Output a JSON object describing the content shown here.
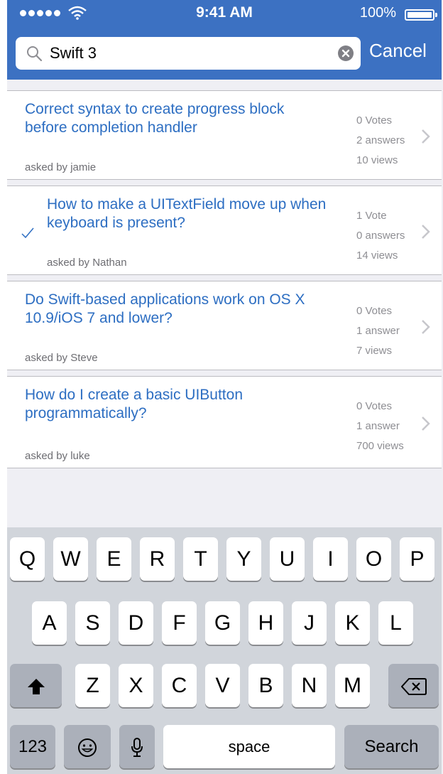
{
  "status_bar": {
    "time": "9:41 AM",
    "battery": "100%"
  },
  "search": {
    "query": "Swift 3",
    "cancel_label": "Cancel"
  },
  "results": [
    {
      "title": "Correct syntax to create progress block before completion handler",
      "asked": "asked by jamie",
      "votes": "0 Votes",
      "answers": "2 answers",
      "views": "10 views",
      "checked": false
    },
    {
      "title": "How to make a UITextField move up when keyboard is present?",
      "asked": "asked by Nathan",
      "votes": "1 Vote",
      "answers": "0 answers",
      "views": "14 views",
      "checked": true
    },
    {
      "title": "Do Swift-based applications work on OS X 10.9/iOS 7 and lower?",
      "asked": "asked by Steve",
      "votes": "0 Votes",
      "answers": "1 answer",
      "views": "7 views",
      "checked": false
    },
    {
      "title": "How do I create a basic UIButton programmatically?",
      "asked": "asked by luke",
      "votes": "0 Votes",
      "answers": "1 answer",
      "views": "700 views",
      "checked": false
    }
  ],
  "keyboard": {
    "row1": [
      "Q",
      "W",
      "E",
      "R",
      "T",
      "Y",
      "U",
      "I",
      "O",
      "P"
    ],
    "row2": [
      "A",
      "S",
      "D",
      "F",
      "G",
      "H",
      "J",
      "K",
      "L"
    ],
    "row3": [
      "Z",
      "X",
      "C",
      "V",
      "B",
      "N",
      "M"
    ],
    "numbers_label": "123",
    "space_label": "space",
    "return_label": "Search"
  },
  "icons": {
    "shift": "shift-icon",
    "delete": "delete-icon",
    "emoji": "emoji-icon",
    "mic": "microphone-icon"
  },
  "colors": {
    "header": "#3c71c2",
    "link": "#2d6ec2",
    "keyboard_bg": "#d1d5db"
  }
}
